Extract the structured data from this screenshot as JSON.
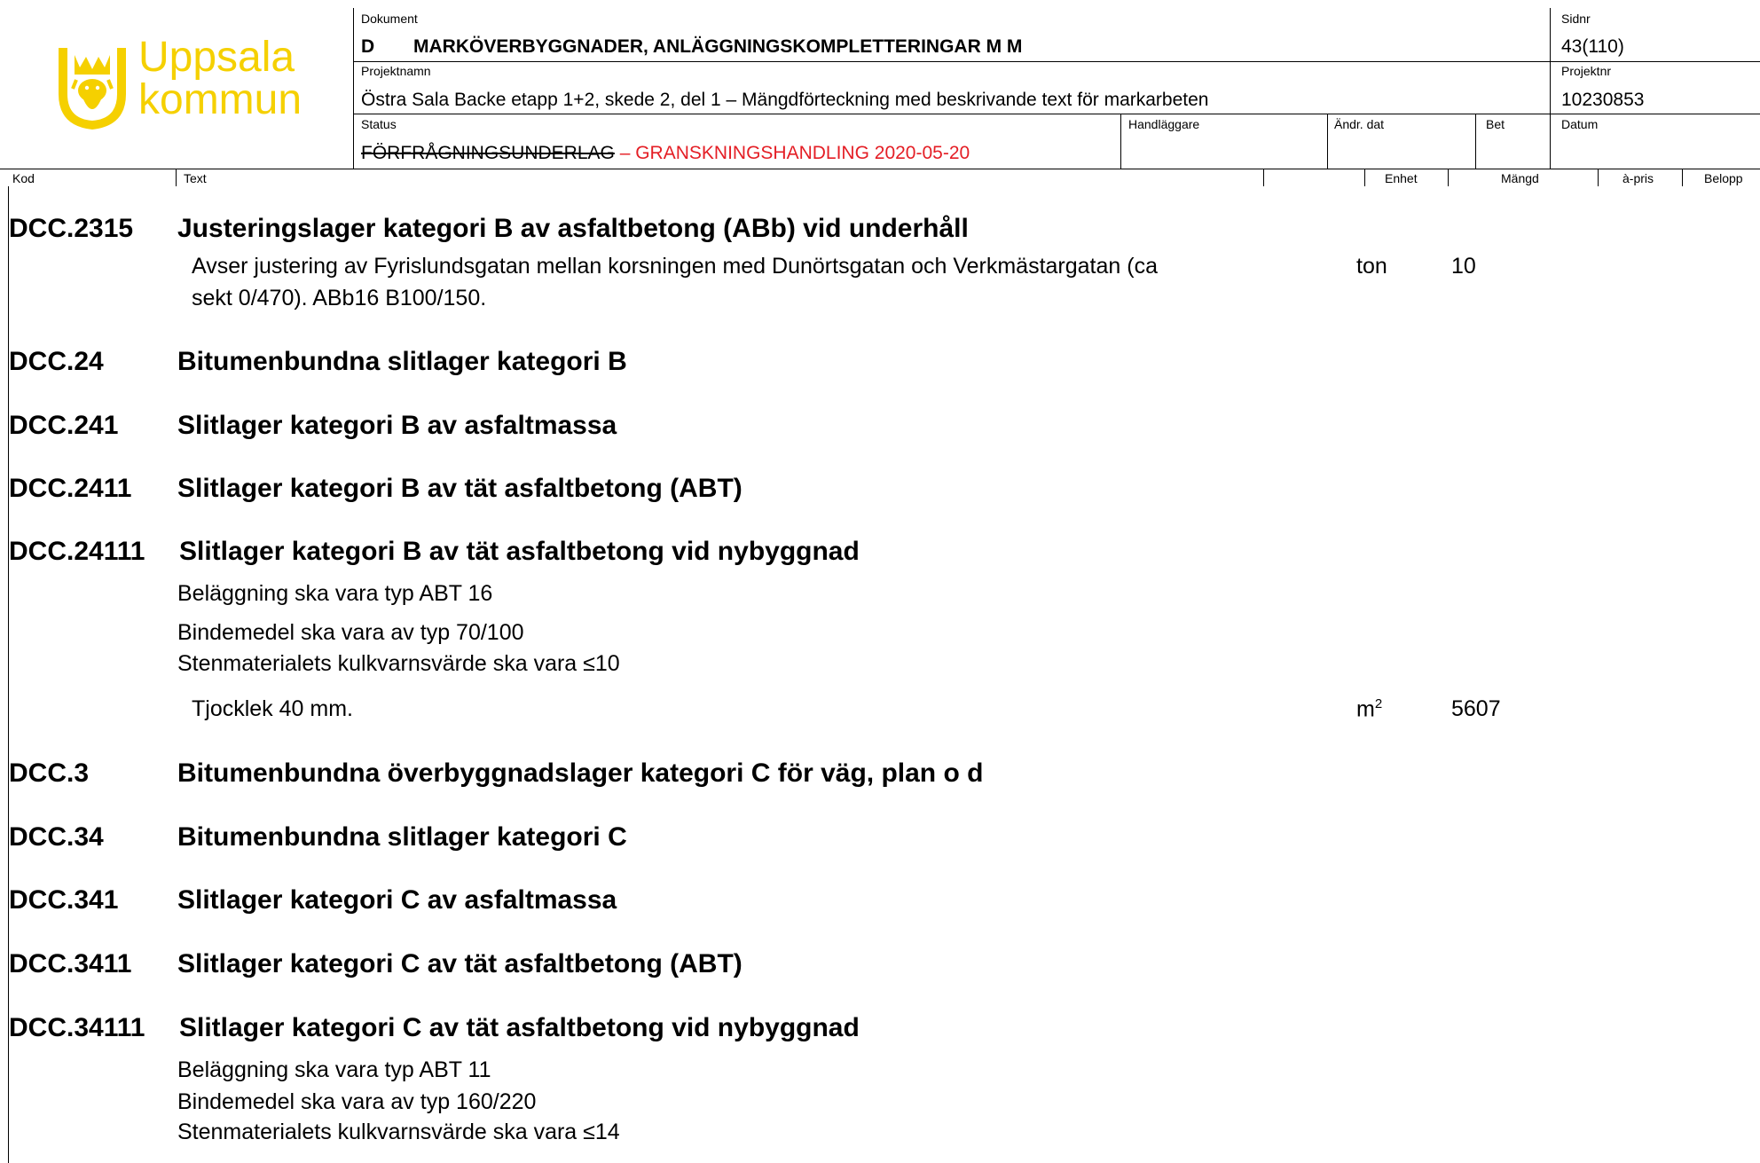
{
  "logo": {
    "line1": "Uppsala",
    "line2": "kommun",
    "color": "#f5d000"
  },
  "header": {
    "dokument_label": "Dokument",
    "dokument_code": "D",
    "dokument_value": "MARKÖVERBYGGNADER, ANLÄGGNINGSKOMPLETTERINGAR M M",
    "sidnr_label": "Sidnr",
    "sidnr_value": "43(110)",
    "projektnamn_label": "Projektnamn",
    "projektnamn_value": "Östra Sala Backe etapp 1+2, skede 2, del 1 – Mängdförteckning med beskrivande text för markarbeten",
    "projektnr_label": "Projektnr",
    "projektnr_value": "10230853",
    "status_label": "Status",
    "status_struck": "FÖRFRÅGNINGSUNDERLAG",
    "status_dash": " – ",
    "status_current": "GRANSKNINGSHANDLING 2020-05-20",
    "handlaggare_label": "Handläggare",
    "andr_dat_label": "Ändr. dat",
    "bet_label": "Bet",
    "datum_label": "Datum"
  },
  "columns": {
    "kod": "Kod",
    "text": "Text",
    "enhet": "Enhet",
    "mangd": "Mängd",
    "apris": "à-pris",
    "belopp": "Belopp"
  },
  "sections": {
    "s1": {
      "code": "DCC.2315",
      "title": "Justeringslager kategori B av asfaltbetong (ABb) vid underhåll",
      "desc1": "Avser justering av Fyrislundsgatan mellan korsningen med Dunörtsgatan och Verkmästargatan (ca",
      "desc2": "sekt 0/470). ABb16 B100/150.",
      "unit": "ton",
      "qty": "10"
    },
    "s2": {
      "code": "DCC.24",
      "title": "Bitumenbundna slitlager kategori B"
    },
    "s3": {
      "code": "DCC.241",
      "title": "Slitlager kategori B av asfaltmassa"
    },
    "s4": {
      "code": "DCC.2411",
      "title": "Slitlager kategori B av tät asfaltbetong (ABT)"
    },
    "s5": {
      "code": "DCC.24111",
      "title": "Slitlager kategori B av tät asfaltbetong vid nybyggnad",
      "line1": "Beläggning ska vara typ ABT 16",
      "line2": "Bindemedel ska vara av typ 70/100",
      "line3": "Stenmaterialets kulkvarnsvärde ska vara ≤10",
      "line4": "Tjocklek 40 mm.",
      "unit": "m",
      "unit_sup": "2",
      "qty": "5607"
    },
    "s6": {
      "code": "DCC.3",
      "title": "Bitumenbundna överbyggnadslager kategori C för väg, plan o d"
    },
    "s7": {
      "code": "DCC.34",
      "title": "Bitumenbundna slitlager kategori C"
    },
    "s8": {
      "code": "DCC.341",
      "title": "Slitlager kategori C av asfaltmassa"
    },
    "s9": {
      "code": "DCC.3411",
      "title": "Slitlager kategori C av tät asfaltbetong (ABT)"
    },
    "s10": {
      "code": "DCC.34111",
      "title": "Slitlager kategori C av tät asfaltbetong vid nybyggnad",
      "line1": "Beläggning ska vara typ ABT 11",
      "line2": "Bindemedel ska vara av typ 160/220",
      "line3": "Stenmaterialets kulkvarnsvärde ska vara ≤14"
    }
  }
}
